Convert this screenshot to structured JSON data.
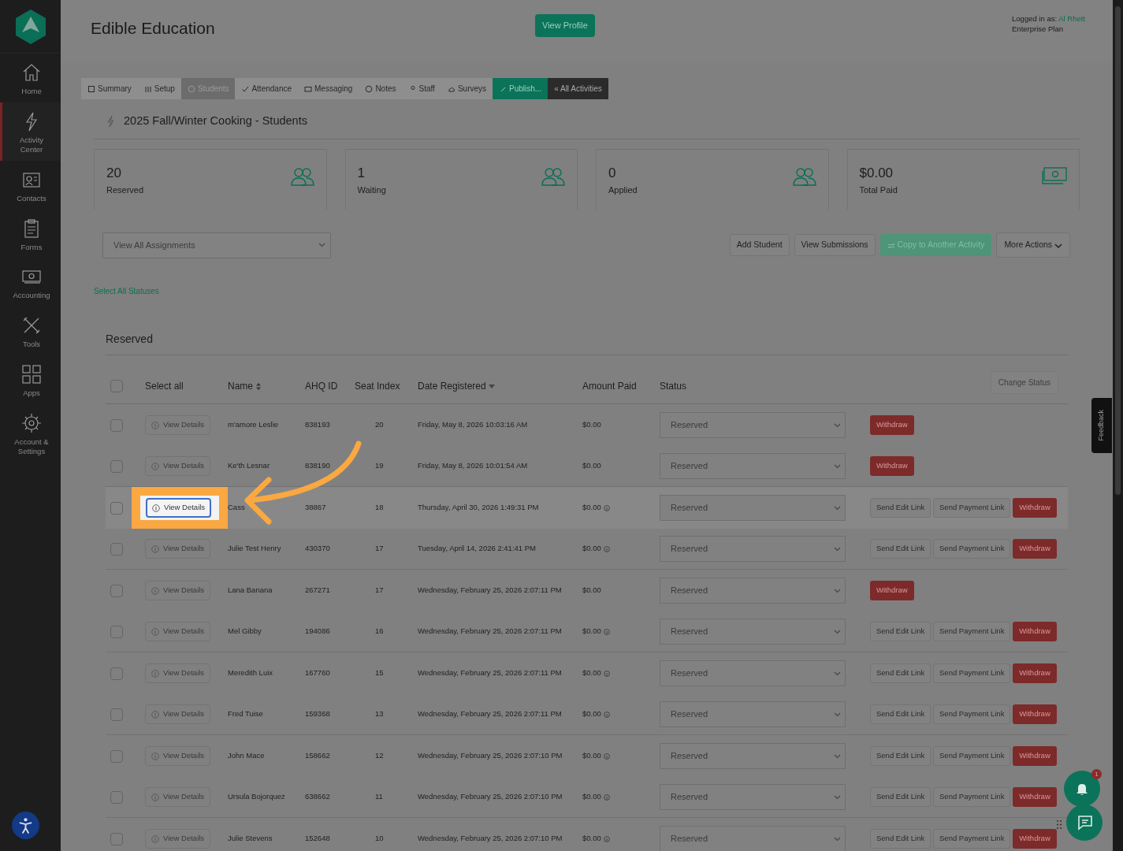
{
  "sidebar": {
    "items": [
      {
        "label": "Home",
        "selected": false
      },
      {
        "label": "Activity Center",
        "selected": true
      },
      {
        "label": "Contacts",
        "selected": false
      },
      {
        "label": "Forms",
        "selected": false
      },
      {
        "label": "Accounting",
        "selected": false
      },
      {
        "label": "Tools",
        "selected": false
      },
      {
        "label": "Apps",
        "selected": false
      },
      {
        "label": "Account & Settings",
        "selected": false
      }
    ]
  },
  "header": {
    "title": "Edible Education",
    "profile_button": "View Profile",
    "logged_in_label": "Logged in as:",
    "user": "Al Rhett",
    "plan": "Enterprise Plan"
  },
  "tabs": [
    {
      "label": "Summary",
      "kind": "tab",
      "selected": false
    },
    {
      "label": "Setup",
      "kind": "tab",
      "selected": false
    },
    {
      "label": "Students",
      "kind": "tab",
      "selected": true
    },
    {
      "label": "Attendance",
      "kind": "tab",
      "selected": false
    },
    {
      "label": "Messaging",
      "kind": "tab",
      "selected": false
    },
    {
      "label": "Notes",
      "kind": "tab",
      "selected": false
    },
    {
      "label": "Staff",
      "kind": "tab",
      "selected": false
    },
    {
      "label": "Surveys",
      "kind": "tab",
      "selected": false
    },
    {
      "label": "Publish...",
      "kind": "publish",
      "selected": false
    },
    {
      "label": "« All Activities",
      "kind": "back",
      "selected": false
    }
  ],
  "page_title": "2025 Fall/Winter Cooking - Students",
  "stats": [
    {
      "value": "20",
      "label": "Reserved",
      "kind": "count"
    },
    {
      "value": "1",
      "label": "Waiting",
      "kind": "count"
    },
    {
      "value": "0",
      "label": "Applied",
      "kind": "count"
    },
    {
      "value": "$0.00",
      "label": "Total Paid",
      "kind": "amount"
    }
  ],
  "assignment_select": {
    "value": "View All Assignments"
  },
  "actions": [
    {
      "label": "Add Student",
      "kind": "outline"
    },
    {
      "label": "View Submissions",
      "kind": "outline"
    },
    {
      "label": "Copy to Another Activity",
      "kind": "copy"
    },
    {
      "label": "More Actions",
      "kind": "dropdown"
    }
  ],
  "select_all_statuses": "Select All Statuses",
  "section": {
    "title": "Reserved",
    "change_status": "Change Status",
    "select_all": {
      "label": "Select all",
      "checked": false
    },
    "columns": [
      "Name",
      "AHQ ID",
      "Seat Index",
      "Date Registered",
      "Amount Paid",
      "Status"
    ],
    "rows": [
      {
        "checked": false,
        "details": "View Details",
        "name": "m'amore Leslie",
        "id": "838193",
        "seat": "20",
        "date": "Friday, May 8, 2026 10:03:16 AM",
        "amount": "$0.00",
        "info": false,
        "status": "Reserved",
        "buttons": [
          {
            "label": "Withdraw",
            "kind": "danger"
          }
        ],
        "spotlight": false
      },
      {
        "checked": false,
        "details": "View Details",
        "name": "Ke'th Lesnar",
        "id": "838190",
        "seat": "19",
        "date": "Friday, May 8, 2026 10:01:54 AM",
        "amount": "$0.00",
        "info": false,
        "status": "Reserved",
        "buttons": [
          {
            "label": "Withdraw",
            "kind": "danger"
          }
        ],
        "spotlight": false
      },
      {
        "checked": false,
        "details": "View Details",
        "name": "Cass",
        "id": "38867",
        "seat": "18",
        "date": "Thursday, April 30, 2026 1:49:31 PM",
        "amount": "$0.00",
        "info": true,
        "status": "Reserved",
        "buttons": [
          {
            "label": "Send Edit Link",
            "kind": "plain"
          },
          {
            "label": "Send Payment Link",
            "kind": "plain"
          },
          {
            "label": "Withdraw",
            "kind": "danger"
          }
        ],
        "spotlight": true
      },
      {
        "checked": false,
        "details": "View Details",
        "name": "Julie Test Henry",
        "id": "430370",
        "seat": "17",
        "date": "Tuesday, April 14, 2026 2:41:41 PM",
        "amount": "$0.00",
        "info": true,
        "status": "Reserved",
        "buttons": [
          {
            "label": "Send Edit Link",
            "kind": "plain"
          },
          {
            "label": "Send Payment Link",
            "kind": "plain"
          },
          {
            "label": "Withdraw",
            "kind": "danger"
          }
        ],
        "spotlight": false
      },
      {
        "checked": false,
        "details": "View Details",
        "name": "Lana Banana",
        "id": "267271",
        "seat": "17",
        "date": "Wednesday, February 25, 2026 2:07:11 PM",
        "amount": "$0.00",
        "info": false,
        "status": "Reserved",
        "buttons": [
          {
            "label": "Withdraw",
            "kind": "danger"
          }
        ],
        "spotlight": false
      },
      {
        "checked": false,
        "details": "View Details",
        "name": "Mel Gibby",
        "id": "194086",
        "seat": "16",
        "date": "Wednesday, February 25, 2026 2:07:11 PM",
        "amount": "$0.00",
        "info": true,
        "status": "Reserved",
        "buttons": [
          {
            "label": "Send Edit Link",
            "kind": "plain"
          },
          {
            "label": "Send Payment Link",
            "kind": "plain"
          },
          {
            "label": "Withdraw",
            "kind": "danger"
          }
        ],
        "spotlight": false
      },
      {
        "checked": false,
        "details": "View Details",
        "name": "Meredith Luix",
        "id": "167760",
        "seat": "15",
        "date": "Wednesday, February 25, 2026 2:07:11 PM",
        "amount": "$0.00",
        "info": true,
        "status": "Reserved",
        "buttons": [
          {
            "label": "Send Edit Link",
            "kind": "plain"
          },
          {
            "label": "Send Payment Link",
            "kind": "plain"
          },
          {
            "label": "Withdraw",
            "kind": "danger"
          }
        ],
        "spotlight": false
      },
      {
        "checked": false,
        "details": "View Details",
        "name": "Fred Tuise",
        "id": "159368",
        "seat": "13",
        "date": "Wednesday, February 25, 2026 2:07:11 PM",
        "amount": "$0.00",
        "info": true,
        "status": "Reserved",
        "buttons": [
          {
            "label": "Send Edit Link",
            "kind": "plain"
          },
          {
            "label": "Send Payment Link",
            "kind": "plain"
          },
          {
            "label": "Withdraw",
            "kind": "danger"
          }
        ],
        "spotlight": false
      },
      {
        "checked": false,
        "details": "View Details",
        "name": "John Mace",
        "id": "158662",
        "seat": "12",
        "date": "Wednesday, February 25, 2026 2:07:10 PM",
        "amount": "$0.00",
        "info": true,
        "status": "Reserved",
        "buttons": [
          {
            "label": "Send Edit Link",
            "kind": "plain"
          },
          {
            "label": "Send Payment Link",
            "kind": "plain"
          },
          {
            "label": "Withdraw",
            "kind": "danger"
          }
        ],
        "spotlight": false
      },
      {
        "checked": false,
        "details": "View Details",
        "name": "Ursula Bojorquez",
        "id": "638662",
        "seat": "11",
        "date": "Wednesday, February 25, 2026 2:07:10 PM",
        "amount": "$0.00",
        "info": true,
        "status": "Reserved",
        "buttons": [
          {
            "label": "Send Edit Link",
            "kind": "plain"
          },
          {
            "label": "Send Payment Link",
            "kind": "plain"
          },
          {
            "label": "Withdraw",
            "kind": "danger"
          }
        ],
        "spotlight": false
      },
      {
        "checked": false,
        "details": "View Details",
        "name": "Julie Stevens",
        "id": "152648",
        "seat": "10",
        "date": "Wednesday, February 25, 2026 2:07:10 PM",
        "amount": "$0.00",
        "info": true,
        "status": "Reserved",
        "buttons": [
          {
            "label": "Send Edit Link",
            "kind": "plain"
          },
          {
            "label": "Send Payment Link",
            "kind": "plain"
          },
          {
            "label": "Withdraw",
            "kind": "danger"
          }
        ],
        "spotlight": false
      }
    ]
  },
  "feedback_tab": "Feedback",
  "notification_badge": "1"
}
